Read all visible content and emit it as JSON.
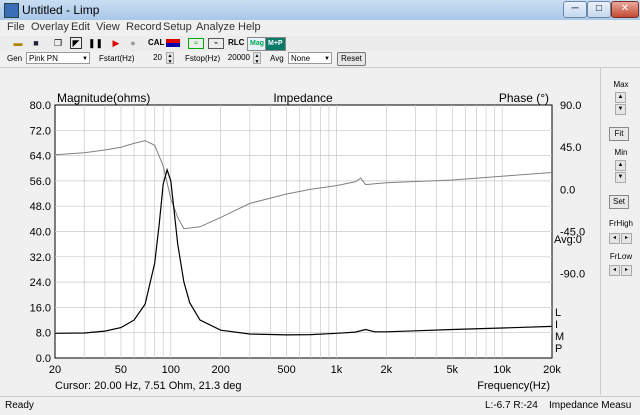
{
  "window": {
    "title": "Untitled - Limp"
  },
  "menu": [
    "File",
    "Overlay",
    "Edit",
    "View",
    "Record",
    "Setup",
    "Analyze",
    "Help"
  ],
  "toolbar": {
    "cal": "CAL",
    "rlc": "RLC",
    "mag": "Mag",
    "mp": "M+P"
  },
  "genbar": {
    "gen_label": "Gen",
    "gen_value": "Pink PN",
    "fstart_label": "Fstart(Hz)",
    "fstart_value": "20",
    "fstop_label": "Fstop(Hz)",
    "fstop_value": "20000",
    "avg_label": "Avg",
    "avg_value": "None",
    "reset_label": "Reset"
  },
  "side": {
    "max": "Max",
    "fit": "Fit",
    "min": "Min",
    "set": "Set",
    "frhigh": "FrHigh",
    "frlow": "FrLow"
  },
  "status": {
    "ready": "Ready",
    "lr": "L:-6.7 R:-24",
    "mode": "Impedance Measu"
  },
  "chart_data": {
    "type": "line",
    "title": "Impedance",
    "left_axis_label": "Magnitude(ohms)",
    "right_axis_label": "Phase (°)",
    "xlabel": "Frequency(Hz)",
    "x_scale": "log",
    "xlim": [
      20,
      20000
    ],
    "x_ticks": [
      "20",
      "50",
      "100",
      "200",
      "500",
      "1k",
      "2k",
      "5k",
      "10k",
      "20k"
    ],
    "y_left_ticks": [
      "80.0",
      "72.0",
      "64.0",
      "56.0",
      "48.0",
      "40.0",
      "32.0",
      "24.0",
      "16.0",
      "8.0",
      "0.0"
    ],
    "y_right_ticks": [
      "90.0",
      "45.0",
      "0.0",
      "-45.0",
      "-90.0"
    ],
    "ylim_left": [
      0,
      80
    ],
    "ylim_right": [
      -180,
      90
    ],
    "avg_text": "Avg:0",
    "limp_letters": [
      "L",
      "I",
      "M",
      "P"
    ],
    "cursor_text": "Cursor: 20.00 Hz, 7.51 Ohm, 21.3 deg",
    "grid": true,
    "series": [
      {
        "name": "Magnitude",
        "axis": "left",
        "color": "#000000",
        "x": [
          20,
          30,
          40,
          50,
          60,
          70,
          80,
          85,
          90,
          95,
          100,
          105,
          110,
          120,
          130,
          150,
          200,
          300,
          500,
          700,
          1000,
          1300,
          1500,
          1700,
          2000,
          3000,
          5000,
          10000,
          20000
        ],
        "y": [
          7.8,
          7.9,
          8.5,
          9.6,
          12.0,
          17.0,
          30.0,
          42.0,
          55.0,
          59.5,
          56.0,
          46.0,
          36.0,
          24.0,
          17.5,
          12.0,
          8.8,
          7.6,
          7.3,
          7.4,
          7.8,
          8.2,
          9.0,
          8.3,
          8.3,
          8.6,
          9.0,
          9.5,
          10.0
        ]
      },
      {
        "name": "Phase",
        "axis": "right",
        "color": "#808080",
        "x": [
          20,
          30,
          40,
          50,
          60,
          70,
          80,
          90,
          100,
          110,
          120,
          150,
          200,
          300,
          500,
          700,
          1000,
          1300,
          1400,
          1500,
          2000,
          5000,
          10000,
          20000
        ],
        "y": [
          37,
          39,
          42,
          45,
          49,
          52,
          47,
          25,
          -10,
          -30,
          -42,
          -40,
          -30,
          -15,
          -5,
          0,
          4,
          8,
          12,
          5,
          7,
          10,
          14,
          18
        ]
      }
    ]
  }
}
